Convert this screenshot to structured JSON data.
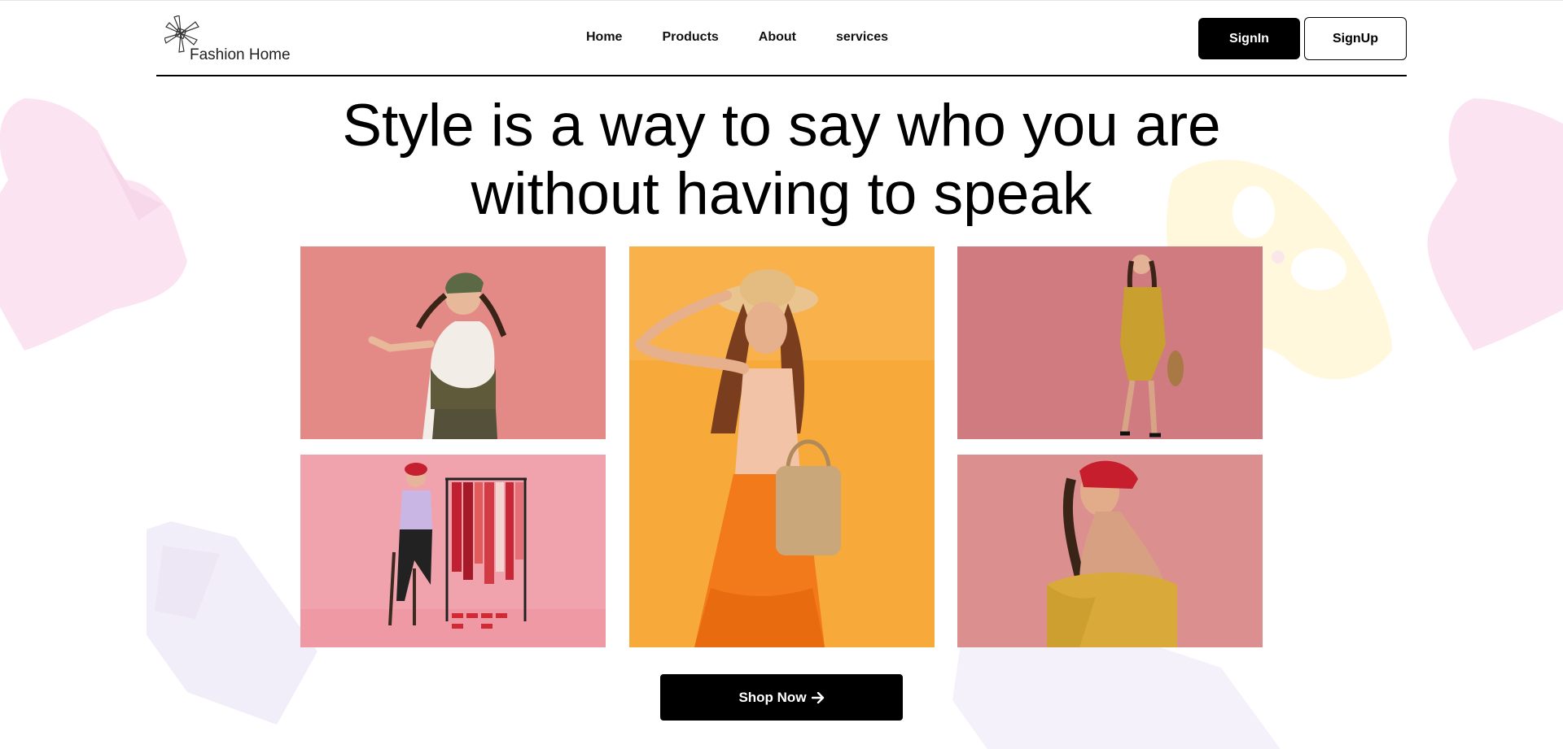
{
  "brand": {
    "name": "Fashion Home",
    "logo_icon": "pinwheel-logo-icon"
  },
  "nav": {
    "items": [
      {
        "label": "Home"
      },
      {
        "label": "Products"
      },
      {
        "label": "About"
      },
      {
        "label": "services"
      }
    ]
  },
  "auth": {
    "signin_label": "SignIn",
    "signup_label": "SignUp"
  },
  "hero": {
    "title_line1": "Style is a way to say who you are",
    "title_line2": "without having to speak"
  },
  "gallery": {
    "photos": [
      {
        "subject": "woman in green beanie dancing",
        "bg_color": "#e38a86"
      },
      {
        "subject": "woman in straw hat with orange skirt and basket",
        "bg_color": "#f7a93a"
      },
      {
        "subject": "woman in yellow dress with straw bag",
        "bg_color": "#cf7b7f"
      },
      {
        "subject": "woman with clothes rack and shoes",
        "bg_color": "#f0a3ac"
      },
      {
        "subject": "woman in red headscarf and yellow top",
        "bg_color": "#dc8f8f"
      }
    ]
  },
  "cta": {
    "label": "Shop Now",
    "icon": "arrow-right-icon"
  },
  "colors": {
    "primary": "#000000",
    "background": "#ffffff",
    "deco_pink": "#fbe6f3",
    "deco_yellow": "#fffbe6",
    "deco_lilac": "#f3effa"
  }
}
